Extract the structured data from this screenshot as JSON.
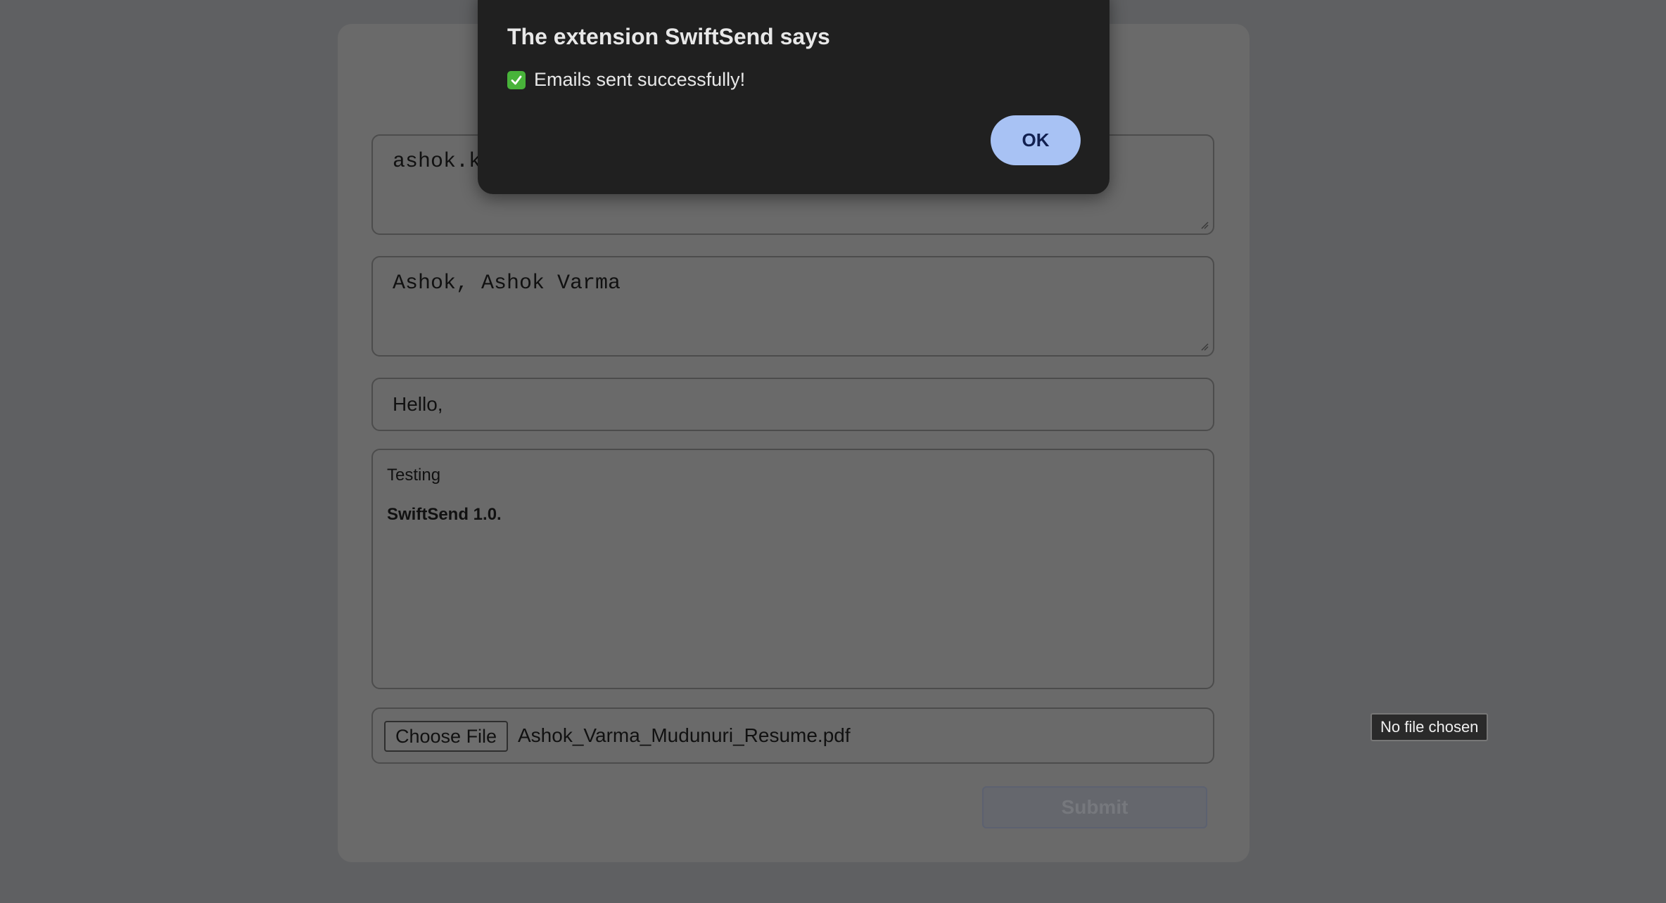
{
  "form": {
    "recipient_emails_value": "ashok.k",
    "recipient_names_value": "Ashok, Ashok Varma",
    "subject_value": "Hello,",
    "body_line1": "Testing",
    "body_line2": "SwiftSend 1.0.",
    "choose_file_label": "Choose File",
    "attached_file_name": "Ashok_Varma_Mudunuri_Resume.pdf",
    "submit_label": "Submit"
  },
  "tooltip": {
    "text": "No file chosen"
  },
  "dialog": {
    "title": "The extension SwiftSend says",
    "message_icon": "check-mark-icon",
    "message": "Emails sent successfully!",
    "ok_label": "OK"
  },
  "colors": {
    "page_overlay": "#5f6062",
    "dialog_background": "#202020",
    "ok_button": "#a8c2f4",
    "check_icon": "#48b33a"
  }
}
